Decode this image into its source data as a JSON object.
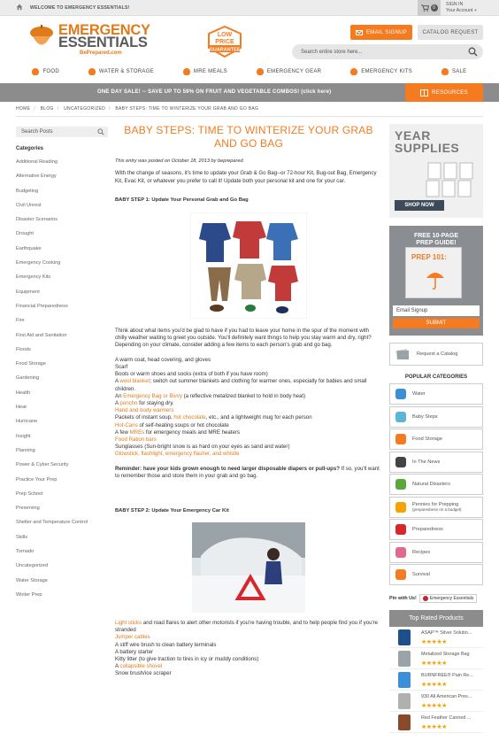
{
  "topbar": {
    "welcome": "WELCOME TO EMERGENCY ESSENTIALS!",
    "cart_count": "0",
    "signin": "SIGN IN",
    "account": "Your Account +"
  },
  "logo": {
    "line1": "EMERGENCY",
    "line2": "ESSENTIALS",
    "tagline": "BePrepared.com",
    "badge_top": "LOW",
    "badge_mid": "PRICE",
    "badge_bottom": "GUARANTEE"
  },
  "header": {
    "email_signup": "EMAIL SIGNUP",
    "catalog_request": "CATALOG REQUEST",
    "search_placeholder": "Search entire store here..."
  },
  "nav": [
    "FOOD",
    "WATER & STORAGE",
    "MRE MEALS",
    "EMERGENCY GEAR",
    "EMERGENCY KITS",
    "SALE"
  ],
  "promo": {
    "text": "ONE DAY SALE! -- SAVE UP TO 59% ON FRUIT AND VEGETABLE COMBOS! (click here)",
    "resources": "RESOURCES"
  },
  "breadcrumb": [
    "HOME",
    "BLOG",
    "UNCATEGORIZED",
    "BABY STEPS: TIME TO WINTERIZE YOUR GRAB AND GO BAG"
  ],
  "sidebar": {
    "search_label": "Search Posts",
    "categories_title": "Categories",
    "categories": [
      "Additional Reading",
      "Alternative Energy",
      "Budgeting",
      "Civil Unrest",
      "Disaster Scenarios",
      "Drought",
      "Earthquake",
      "Emergency Cooking",
      "Emergency Kits",
      "Equipment",
      "Financial Preparedness",
      "Fire",
      "First Aid and Sanitation",
      "Floods",
      "Food Storage",
      "Gardening",
      "Health",
      "Heat",
      "Hurricane",
      "Insight",
      "Planning",
      "Power & Cyber Security",
      "Practice Your Prep",
      "Prep School",
      "Preserving",
      "Shelter and Temperature Control",
      "Skills",
      "Tornado",
      "Uncategorized",
      "Water Storage",
      "Winter Prep"
    ]
  },
  "article": {
    "title": "BABY STEPS: TIME TO WINTERIZE YOUR GRAB AND GO BAG",
    "meta": "This entry was posted on October 18, 2013 by beprepared.",
    "intro": "With the change of seasons, it's time to update your Grab & Go Bag--or 72-hour Kit, Bug-out Bag, Emergency Kit, Evac Kit, or whatever you prefer to call it! Update both your personal kit and one for your car.",
    "step1": "BABY STEP 1:  Update Your Personal Grab and Go Bag",
    "para2": "Think about what items you'd be glad to have if you had to leave your home in the spur of the moment with chilly weather waiting to greet you outside. You'll definitely want things to help you stay warm and dry, right? Depending on your climate, consider adding a few items to each person's grab and go bag.",
    "list1": [
      {
        "pre": "A warm coat, head covering, and gloves",
        "link": "",
        "post": ""
      },
      {
        "pre": "Scarf",
        "link": "",
        "post": ""
      },
      {
        "pre": "Boots or warm shoes and socks (extra of both if you have room)",
        "link": "",
        "post": ""
      },
      {
        "pre": "A ",
        "link": "wool blanket",
        "post": "; switch out summer blankets and clothing for warmer ones, especially for babies and small children."
      },
      {
        "pre": "An ",
        "link": "Emergency Bag or Bivvy",
        "post": " (a reflective metalized blanket to hold in body heat)"
      },
      {
        "pre": "A ",
        "link": "poncho",
        "post": " for staying dry."
      },
      {
        "pre": "",
        "link": "Hand and body warmers",
        "post": ""
      },
      {
        "pre": "Packets of instant soup, ",
        "link": "hot chocolate",
        "post": ", etc., and a lightweight mug for each person"
      },
      {
        "pre": "",
        "link": "Hot-Cans",
        "post": " of self-heating soups or hot chocolate"
      },
      {
        "pre": "A few ",
        "link": "MREs",
        "post": " for emergency meals and MRE heaters"
      },
      {
        "pre": "",
        "link": "Food Ration bars",
        "post": ""
      },
      {
        "pre": "Sunglasses (Sun-bright snow is as hard on your eyes as sand and water)",
        "link": "",
        "post": ""
      },
      {
        "pre": "",
        "link": "Glowstick, flashlight, emergency flasher, and whistle",
        "post": ""
      }
    ],
    "reminder_bold": "Reminder: have your kids grown enough to need larger disposable diapers or pull-ups?",
    "reminder_rest": " If so, you'll want to remember those and store them in your grab and go bag.",
    "step2": "BABY STEP 2:  Update Your Emergency Car Kit",
    "list2": [
      {
        "pre": "",
        "link": "Light sticks",
        "post": " and road flares to alert other motorists if you're having trouble, and to help people find you if you're stranded"
      },
      {
        "pre": "",
        "link": "Jumper cables",
        "post": ""
      },
      {
        "pre": "A stiff wire brush to clean battery terminals",
        "link": "",
        "post": ""
      },
      {
        "pre": "A battery starter",
        "link": "",
        "post": ""
      },
      {
        "pre": "Kitty litter (to give traction to tires in icy or muddy conditions)",
        "link": "",
        "post": ""
      },
      {
        "pre": "A ",
        "link": "collapsible shovel",
        "post": ""
      },
      {
        "pre": "Snow brush/ice scraper",
        "link": "",
        "post": ""
      }
    ]
  },
  "right": {
    "ad1_line1": "YEAR",
    "ad1_line2": "SUPPLIES",
    "ad1_button": "SHOP NOW",
    "ad2_line1": "FREE 10-PAGE",
    "ad2_line2": "PREP GUIDE!",
    "ad2_book": "PREP 101:",
    "ad2_input": "Email Signup",
    "ad2_submit": "SUBMIT",
    "request_catalog": "Request a Catalog",
    "popular_title": "POPULAR CATEGORIES",
    "popular": [
      {
        "label": "Water",
        "color": "#3a8fd6"
      },
      {
        "label": "Baby Steps",
        "color": "#5bb5d6"
      },
      {
        "label": "Food Storage",
        "color": "#f47b20"
      },
      {
        "label": "In The News",
        "color": "#444444"
      },
      {
        "label": "Natural Disasters",
        "color": "#5aa83a"
      },
      {
        "label": "Pennies for Prepping",
        "color": "#f4a300"
      },
      {
        "label": "Preparedness",
        "color": "#d9262c"
      },
      {
        "label": "Recipes",
        "color": "#e06a8c"
      },
      {
        "label": "Survival",
        "color": "#f47b20"
      }
    ],
    "pennies_sub": "(preparedness on a budget)",
    "pin_label": "Pin with Us!",
    "pin_tag": "Emergency Essentials",
    "top_rated_title": "Top Rated Products",
    "products": [
      {
        "name": "ASAP™ Silver Solutio...",
        "stars": "★★★★★"
      },
      {
        "name": "Metalized Storage Bag",
        "stars": "★★★★★"
      },
      {
        "name": "BURNFREE® Pain Re...",
        "stars": "★★★★★"
      },
      {
        "name": "930 All American Pres...",
        "stars": "★★★★★"
      },
      {
        "name": "Red Feather Canned ...",
        "stars": "★★★★★"
      }
    ]
  }
}
